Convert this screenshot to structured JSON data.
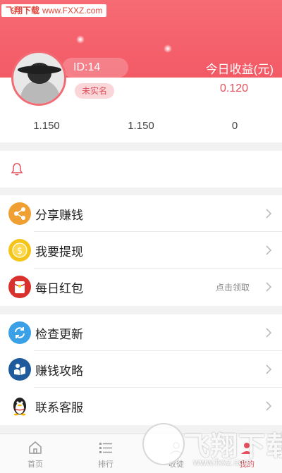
{
  "watermark": {
    "brand": "飞翔下载",
    "url_top": "www.FXXZ.com",
    "logo_text": "飞翔下载",
    "url_bottom": "www.fxxz.com"
  },
  "profile": {
    "id_label": "ID:14",
    "verify_label": "未实名"
  },
  "earnings": {
    "title": "今日收益(元)",
    "value": "0.120"
  },
  "stats": [
    "1.150",
    "1.150",
    "0"
  ],
  "menu_group_1": [
    {
      "label": "分享赚钱",
      "icon": "share-icon",
      "color": "#f0a032"
    },
    {
      "label": "我要提现",
      "icon": "coin-icon",
      "color": "#f5c419"
    },
    {
      "label": "每日红包",
      "icon": "red-envelope-icon",
      "color": "#d9312c",
      "hint": "点击领取"
    }
  ],
  "menu_group_2": [
    {
      "label": "检查更新",
      "icon": "refresh-icon",
      "color": "#3aa0e8"
    },
    {
      "label": "赚钱攻略",
      "icon": "guide-icon",
      "color": "#1e5a9c"
    },
    {
      "label": "联系客服",
      "icon": "qq-penguin-icon",
      "color": "#222222"
    }
  ],
  "bottom_nav": [
    {
      "label": "首页",
      "icon": "home-icon"
    },
    {
      "label": "排行",
      "icon": "list-icon"
    },
    {
      "label": "收徒",
      "icon": "apprentice-icon"
    },
    {
      "label": "我的",
      "icon": "profile-icon",
      "active": true
    }
  ],
  "colors": {
    "header": "#f25a66",
    "accent": "#e4505c"
  }
}
